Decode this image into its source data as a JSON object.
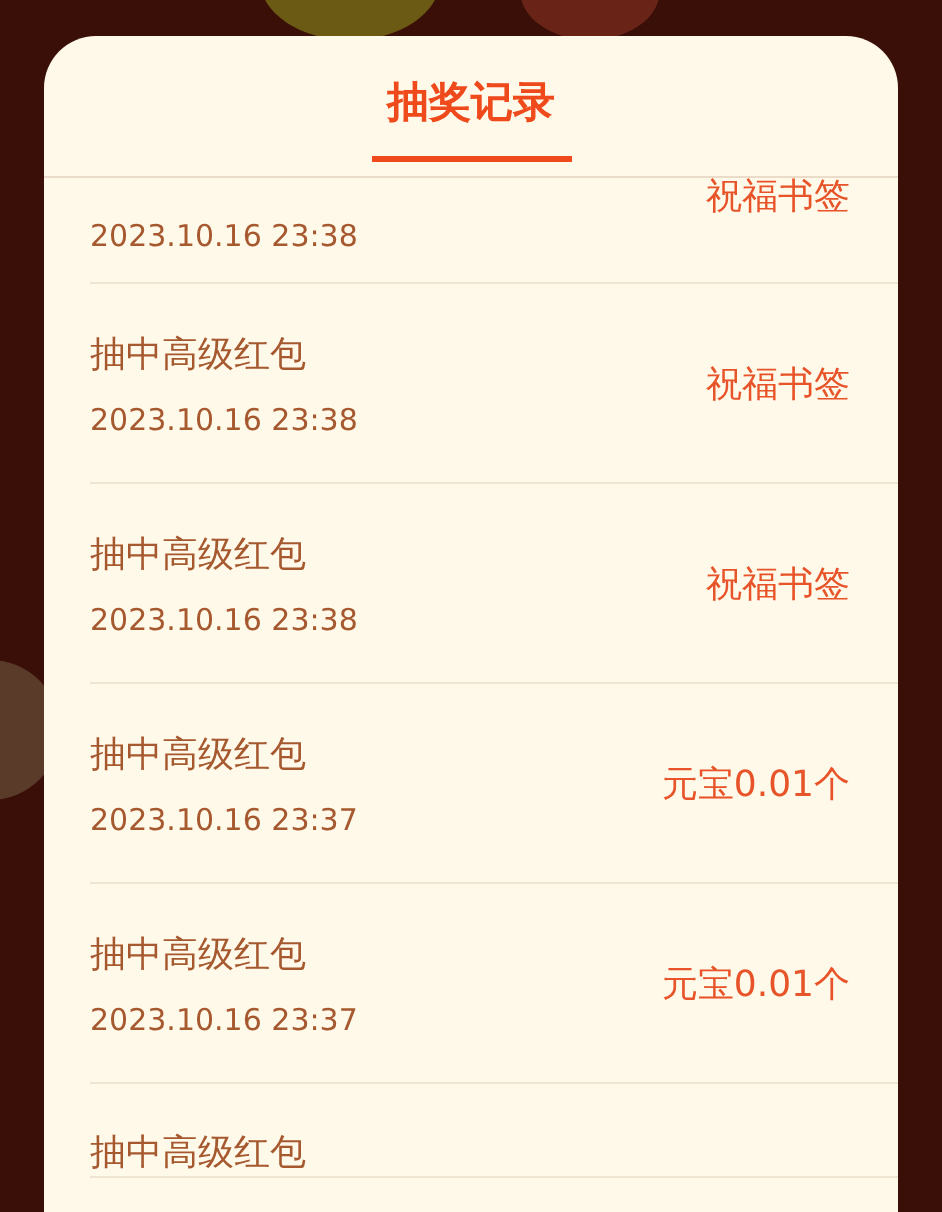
{
  "dialog": {
    "title": "抽奖记录"
  },
  "records": [
    {
      "kind": "partial",
      "date": "2023.10.16 23:38",
      "reward": "祝福书签"
    },
    {
      "kind": "full",
      "title": "抽中高级红包",
      "date": "2023.10.16 23:38",
      "reward": "祝福书签"
    },
    {
      "kind": "full",
      "title": "抽中高级红包",
      "date": "2023.10.16 23:38",
      "reward": "祝福书签"
    },
    {
      "kind": "full",
      "title": "抽中高级红包",
      "date": "2023.10.16 23:37",
      "reward": "元宝0.01个"
    },
    {
      "kind": "full",
      "title": "抽中高级红包",
      "date": "2023.10.16 23:37",
      "reward": "元宝0.01个"
    },
    {
      "kind": "title_only",
      "title": "抽中高级红包"
    }
  ]
}
